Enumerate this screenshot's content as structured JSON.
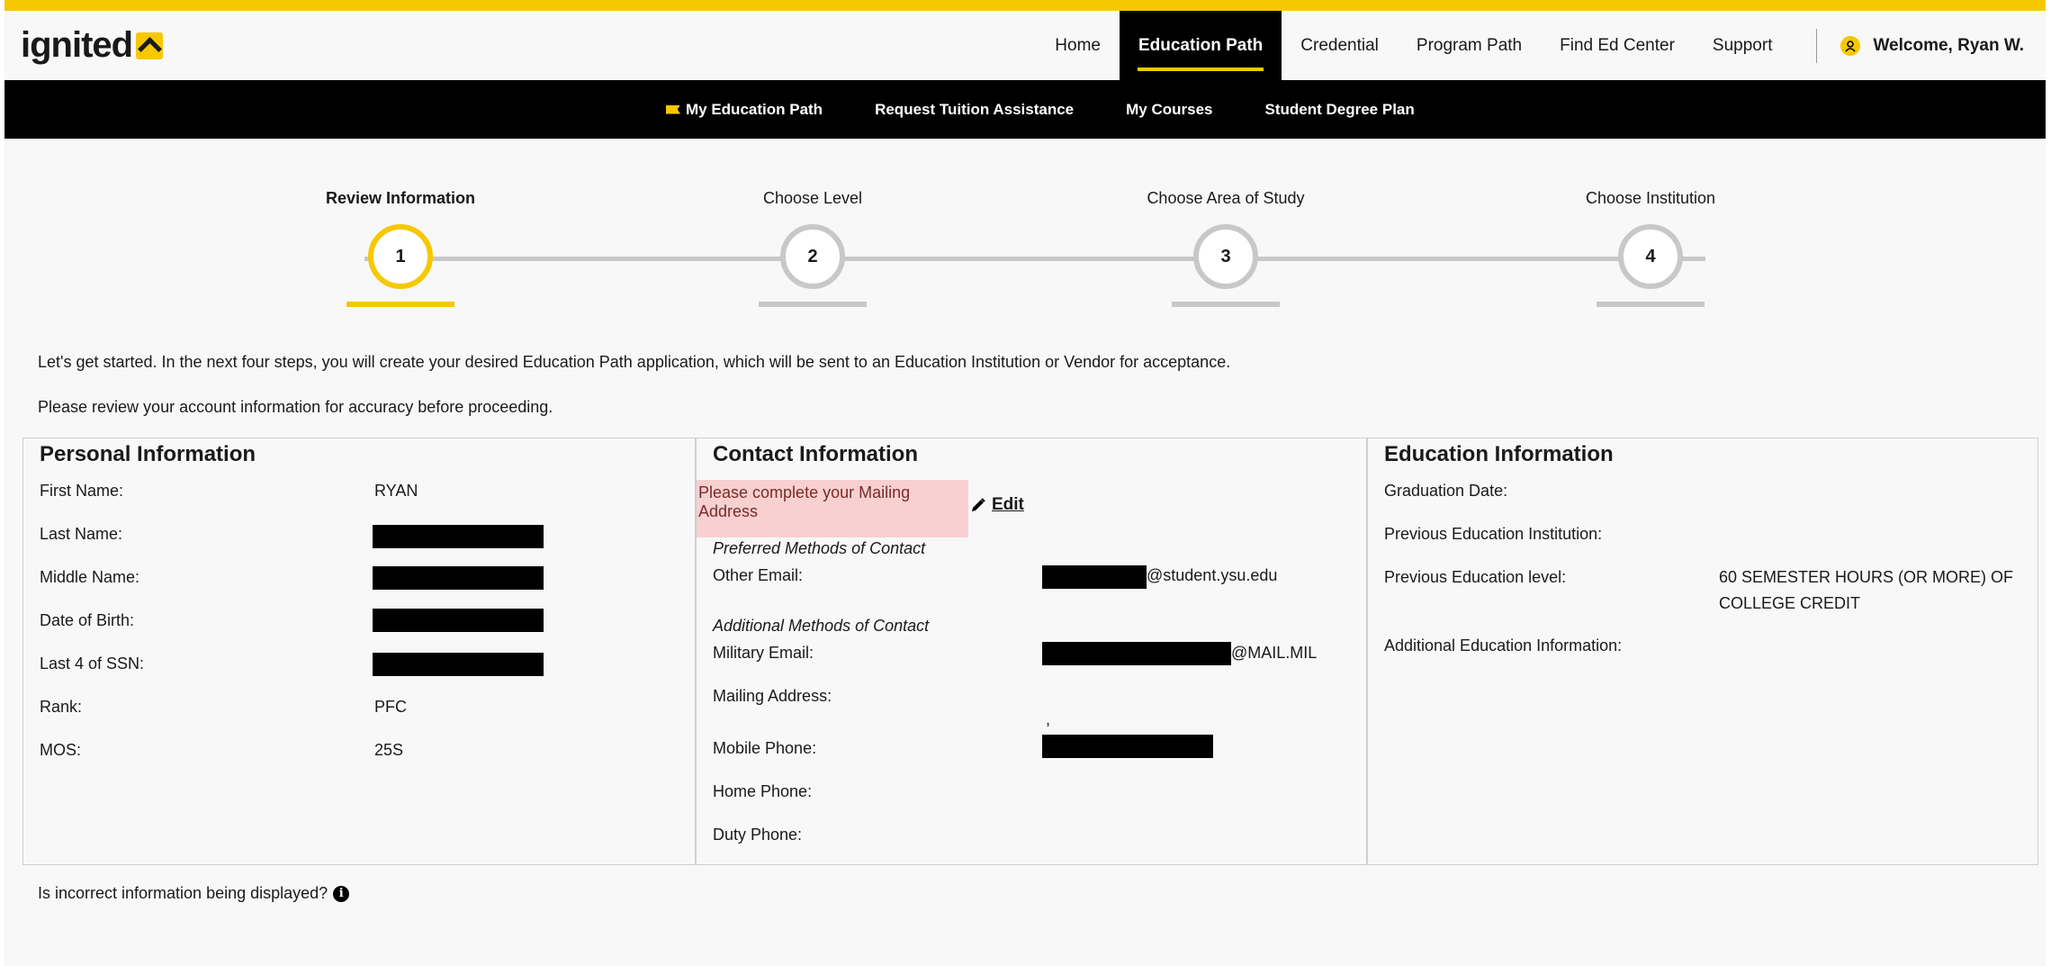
{
  "brand": {
    "logo_text": "ignited"
  },
  "nav": {
    "items": [
      {
        "label": "Home",
        "active": false
      },
      {
        "label": "Education Path",
        "active": true
      },
      {
        "label": "Credential",
        "active": false
      },
      {
        "label": "Program Path",
        "active": false
      },
      {
        "label": "Find Ed Center",
        "active": false
      },
      {
        "label": "Support",
        "active": false
      }
    ],
    "welcome": "Welcome, Ryan W."
  },
  "subnav": {
    "items": [
      {
        "label": "My Education Path"
      },
      {
        "label": "Request Tuition Assistance"
      },
      {
        "label": "My Courses"
      },
      {
        "label": "Student Degree Plan"
      }
    ]
  },
  "stepper": {
    "steps": [
      {
        "label": "Review Information",
        "number": "1",
        "current": true
      },
      {
        "label": "Choose Level",
        "number": "2",
        "current": false
      },
      {
        "label": "Choose Area of Study",
        "number": "3",
        "current": false
      },
      {
        "label": "Choose Institution",
        "number": "4",
        "current": false
      }
    ]
  },
  "intro": {
    "line1": "Let's get started. In the next four steps, you will create your desired Education Path application, which will be sent to an Education Institution or Vendor for acceptance.",
    "line2": "Please review your account information for accuracy before proceeding."
  },
  "personal": {
    "title": "Personal Information",
    "first_name_label": "First Name:",
    "first_name_value": "RYAN",
    "last_name_label": "Last Name:",
    "middle_name_label": "Middle Name:",
    "dob_label": "Date of Birth:",
    "ssn_label": "Last 4 of SSN:",
    "rank_label": "Rank:",
    "rank_value": "PFC",
    "mos_label": "MOS:",
    "mos_value": "25S"
  },
  "contact": {
    "title": "Contact Information",
    "warning": "Please complete your Mailing Address",
    "edit_label": "Edit",
    "preferred_heading": "Preferred Methods of Contact",
    "other_email_label": "Other Email:",
    "other_email_suffix": "@student.ysu.edu",
    "additional_heading": "Additional Methods of Contact",
    "military_email_label": "Military Email:",
    "military_email_suffix": "@MAIL.MIL",
    "mailing_address_label": "Mailing Address:",
    "mailing_address_value": ",",
    "mobile_phone_label": "Mobile Phone:",
    "home_phone_label": "Home Phone:",
    "duty_phone_label": "Duty Phone:"
  },
  "education": {
    "title": "Education Information",
    "graduation_label": "Graduation Date:",
    "prev_institution_label": "Previous Education Institution:",
    "prev_level_label": "Previous Education level:",
    "prev_level_value_1": "60 SEMESTER HOURS (OR MORE) OF",
    "prev_level_value_2": "COLLEGE CREDIT",
    "additional_label": "Additional Education Information:"
  },
  "footer": {
    "question": "Is incorrect information being displayed?"
  },
  "colors": {
    "accent": "#f6c800",
    "nav_bg": "#000000",
    "warning_bg": "#f8d0d0"
  }
}
